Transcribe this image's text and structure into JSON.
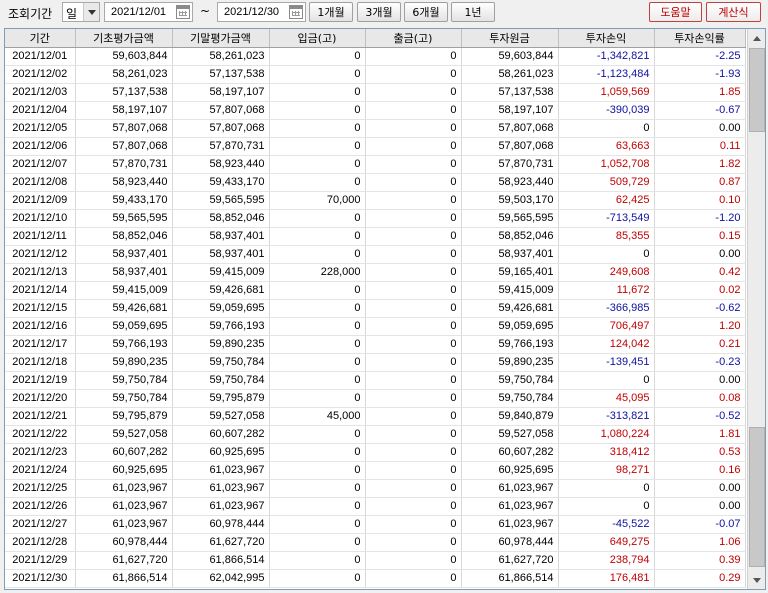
{
  "toolbar": {
    "period_label": "조회기간",
    "unit_value": "일",
    "start_date": "2021/12/01",
    "end_date": "2021/12/30",
    "tilde": "~",
    "btn_1m": "1개월",
    "btn_3m": "3개월",
    "btn_6m": "6개월",
    "btn_1y": "1년",
    "help_label": "도움말",
    "calc_label": "계산식"
  },
  "table": {
    "columns": [
      "기간",
      "기초평가금액",
      "기말평가금액",
      "입금(고)",
      "출금(고)",
      "투자원금",
      "투자손익",
      "투자손익률"
    ],
    "rows": [
      [
        "2021/12/01",
        "59,603,844",
        "58,261,023",
        "0",
        "0",
        "59,603,844",
        "-1,342,821",
        "-2.25"
      ],
      [
        "2021/12/02",
        "58,261,023",
        "57,137,538",
        "0",
        "0",
        "58,261,023",
        "-1,123,484",
        "-1.93"
      ],
      [
        "2021/12/03",
        "57,137,538",
        "58,197,107",
        "0",
        "0",
        "57,137,538",
        "1,059,569",
        "1.85"
      ],
      [
        "2021/12/04",
        "58,197,107",
        "57,807,068",
        "0",
        "0",
        "58,197,107",
        "-390,039",
        "-0.67"
      ],
      [
        "2021/12/05",
        "57,807,068",
        "57,807,068",
        "0",
        "0",
        "57,807,068",
        "0",
        "0.00"
      ],
      [
        "2021/12/06",
        "57,807,068",
        "57,870,731",
        "0",
        "0",
        "57,807,068",
        "63,663",
        "0.11"
      ],
      [
        "2021/12/07",
        "57,870,731",
        "58,923,440",
        "0",
        "0",
        "57,870,731",
        "1,052,708",
        "1.82"
      ],
      [
        "2021/12/08",
        "58,923,440",
        "59,433,170",
        "0",
        "0",
        "58,923,440",
        "509,729",
        "0.87"
      ],
      [
        "2021/12/09",
        "59,433,170",
        "59,565,595",
        "70,000",
        "0",
        "59,503,170",
        "62,425",
        "0.10"
      ],
      [
        "2021/12/10",
        "59,565,595",
        "58,852,046",
        "0",
        "0",
        "59,565,595",
        "-713,549",
        "-1.20"
      ],
      [
        "2021/12/11",
        "58,852,046",
        "58,937,401",
        "0",
        "0",
        "58,852,046",
        "85,355",
        "0.15"
      ],
      [
        "2021/12/12",
        "58,937,401",
        "58,937,401",
        "0",
        "0",
        "58,937,401",
        "0",
        "0.00"
      ],
      [
        "2021/12/13",
        "58,937,401",
        "59,415,009",
        "228,000",
        "0",
        "59,165,401",
        "249,608",
        "0.42"
      ],
      [
        "2021/12/14",
        "59,415,009",
        "59,426,681",
        "0",
        "0",
        "59,415,009",
        "11,672",
        "0.02"
      ],
      [
        "2021/12/15",
        "59,426,681",
        "59,059,695",
        "0",
        "0",
        "59,426,681",
        "-366,985",
        "-0.62"
      ],
      [
        "2021/12/16",
        "59,059,695",
        "59,766,193",
        "0",
        "0",
        "59,059,695",
        "706,497",
        "1.20"
      ],
      [
        "2021/12/17",
        "59,766,193",
        "59,890,235",
        "0",
        "0",
        "59,766,193",
        "124,042",
        "0.21"
      ],
      [
        "2021/12/18",
        "59,890,235",
        "59,750,784",
        "0",
        "0",
        "59,890,235",
        "-139,451",
        "-0.23"
      ],
      [
        "2021/12/19",
        "59,750,784",
        "59,750,784",
        "0",
        "0",
        "59,750,784",
        "0",
        "0.00"
      ],
      [
        "2021/12/20",
        "59,750,784",
        "59,795,879",
        "0",
        "0",
        "59,750,784",
        "45,095",
        "0.08"
      ],
      [
        "2021/12/21",
        "59,795,879",
        "59,527,058",
        "45,000",
        "0",
        "59,840,879",
        "-313,821",
        "-0.52"
      ],
      [
        "2021/12/22",
        "59,527,058",
        "60,607,282",
        "0",
        "0",
        "59,527,058",
        "1,080,224",
        "1.81"
      ],
      [
        "2021/12/23",
        "60,607,282",
        "60,925,695",
        "0",
        "0",
        "60,607,282",
        "318,412",
        "0.53"
      ],
      [
        "2021/12/24",
        "60,925,695",
        "61,023,967",
        "0",
        "0",
        "60,925,695",
        "98,271",
        "0.16"
      ],
      [
        "2021/12/25",
        "61,023,967",
        "61,023,967",
        "0",
        "0",
        "61,023,967",
        "0",
        "0.00"
      ],
      [
        "2021/12/26",
        "61,023,967",
        "61,023,967",
        "0",
        "0",
        "61,023,967",
        "0",
        "0.00"
      ],
      [
        "2021/12/27",
        "61,023,967",
        "60,978,444",
        "0",
        "0",
        "61,023,967",
        "-45,522",
        "-0.07"
      ],
      [
        "2021/12/28",
        "60,978,444",
        "61,627,720",
        "0",
        "0",
        "60,978,444",
        "649,275",
        "1.06"
      ],
      [
        "2021/12/29",
        "61,627,720",
        "61,866,514",
        "0",
        "0",
        "61,627,720",
        "238,794",
        "0.39"
      ],
      [
        "2021/12/30",
        "61,866,514",
        "62,042,995",
        "0",
        "0",
        "61,866,514",
        "176,481",
        "0.29"
      ]
    ]
  },
  "colors": {
    "negative": "#1010a0",
    "positive": "#c00000"
  }
}
